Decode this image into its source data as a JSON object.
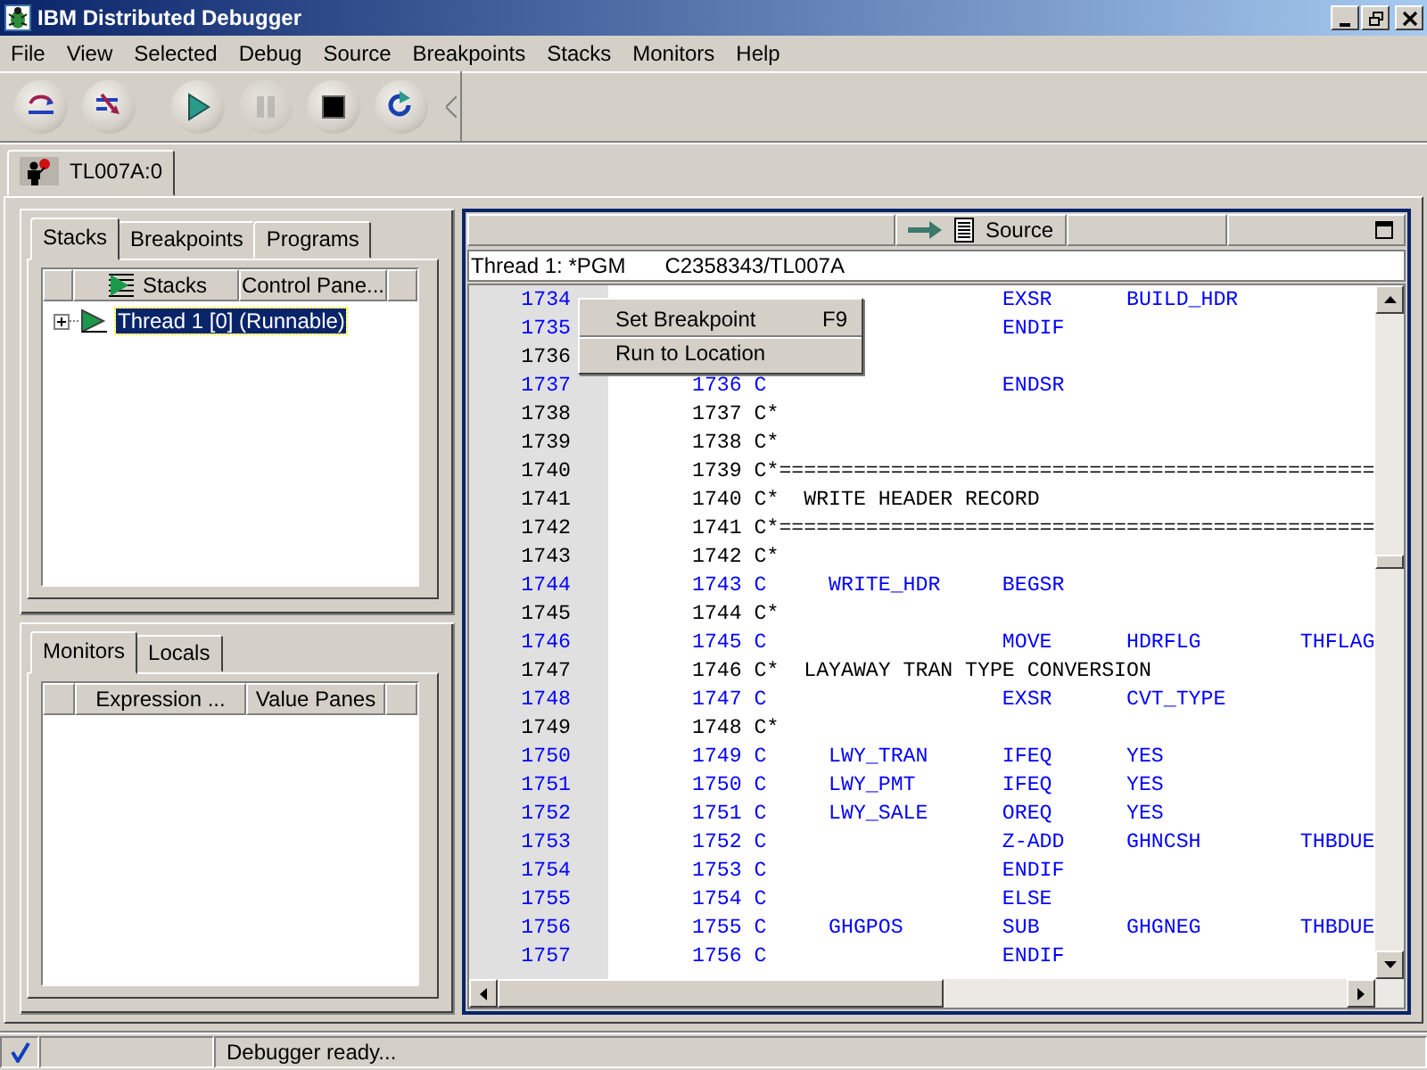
{
  "window": {
    "title": "IBM Distributed Debugger"
  },
  "menu": [
    "File",
    "View",
    "Selected",
    "Debug",
    "Source",
    "Breakpoints",
    "Stacks",
    "Monitors",
    "Help"
  ],
  "toolbar": [
    {
      "kind": "step-over",
      "disabled": false
    },
    {
      "kind": "step-into",
      "disabled": false
    },
    {
      "kind": "run",
      "disabled": false
    },
    {
      "kind": "halt",
      "disabled": true
    },
    {
      "kind": "stop",
      "disabled": false
    },
    {
      "kind": "restart",
      "disabled": false
    }
  ],
  "program_tabs": [
    {
      "label": "TL007A:0",
      "selected": true
    }
  ],
  "stacks_panel": {
    "tabs": [
      {
        "label": "Stacks",
        "selected": true
      },
      {
        "label": "Breakpoints",
        "selected": false
      },
      {
        "label": "Programs",
        "selected": false
      }
    ],
    "columns": [
      "Stacks",
      "Control Pane..."
    ],
    "tree": [
      {
        "label": "Thread 1 [0] (Runnable)",
        "expanded": false,
        "selected": true
      }
    ]
  },
  "monitors_panel": {
    "tabs": [
      {
        "label": "Monitors",
        "selected": true
      },
      {
        "label": "Locals",
        "selected": false
      }
    ],
    "columns": [
      "Expression ...",
      "Value Panes"
    ]
  },
  "source": {
    "title": "Source",
    "thread": "Thread 1: *PGM",
    "program": "C2358343/TL007A",
    "lines": [
      {
        "number": "1734",
        "text": "                         EXSR      BUILD_HDR",
        "executable": true
      },
      {
        "number": "1735",
        "text": "                         ENDIF",
        "executable": true
      },
      {
        "number": "1736",
        "executable": false
      },
      {
        "number": "1737",
        "text": "1736 C                   ENDSR",
        "executable": true
      },
      {
        "number": "1738",
        "text": "1737 C*",
        "executable": false
      },
      {
        "number": "1739",
        "text": "1738 C*",
        "executable": false
      },
      {
        "number": "1740",
        "text": "1739 C*================================================",
        "executable": false
      },
      {
        "number": "1741",
        "text": "1740 C*  WRITE HEADER RECORD",
        "executable": false
      },
      {
        "number": "1742",
        "text": "1741 C*================================================",
        "executable": false
      },
      {
        "number": "1743",
        "text": "1742 C*",
        "executable": false
      },
      {
        "number": "1744",
        "text": "1743 C     WRITE_HDR     BEGSR",
        "executable": true
      },
      {
        "number": "1745",
        "text": "1744 C*",
        "executable": false
      },
      {
        "number": "1746",
        "text": "1745 C                   MOVE      HDRFLG        THFLAG",
        "executable": true
      },
      {
        "number": "1747",
        "text": "1746 C*  LAYAWAY TRAN TYPE CONVERSION",
        "executable": false
      },
      {
        "number": "1748",
        "text": "1747 C                   EXSR      CVT_TYPE",
        "executable": true
      },
      {
        "number": "1749",
        "text": "1748 C*",
        "executable": false
      },
      {
        "number": "1750",
        "text": "1749 C     LWY_TRAN      IFEQ      YES",
        "executable": true
      },
      {
        "number": "1751",
        "text": "1750 C     LWY_PMT       IFEQ      YES",
        "executable": true
      },
      {
        "number": "1752",
        "text": "1751 C     LWY_SALE      OREQ      YES",
        "executable": true
      },
      {
        "number": "1753",
        "text": "1752 C                   Z-ADD     GHNCSH        THBDUE",
        "executable": true
      },
      {
        "number": "1754",
        "text": "1753 C                   ENDIF",
        "executable": true
      },
      {
        "number": "1755",
        "text": "1754 C                   ELSE",
        "executable": true
      },
      {
        "number": "1756",
        "text": "1755 C     GHGPOS        SUB       GHGNEG        THBDUE",
        "executable": true
      },
      {
        "number": "1757",
        "text": "1756 C                   ENDIF",
        "executable": true
      }
    ]
  },
  "context_menu": [
    {
      "label": "Set Breakpoint",
      "shortcut": "F9"
    },
    {
      "label": "Run to Location"
    }
  ],
  "status_bar": {
    "message": "Debugger ready..."
  }
}
